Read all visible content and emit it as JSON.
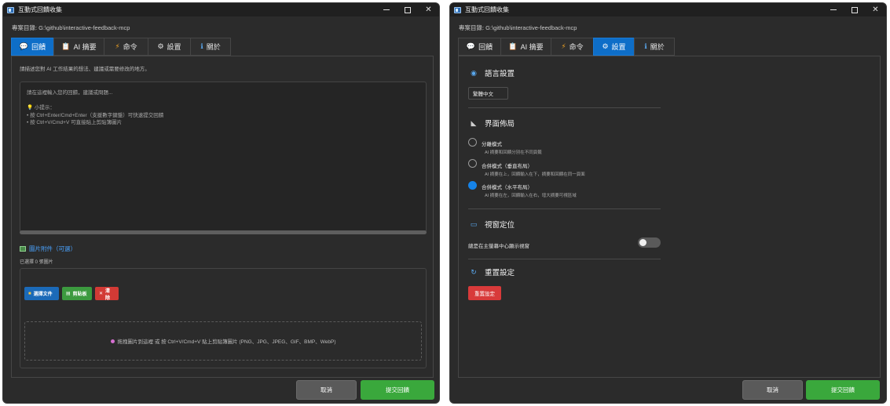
{
  "left": {
    "title": "互動式回饋收集",
    "project_path": "專案目錄: G:\\github\\interactive-feedback-mcp",
    "tabs": [
      {
        "icon": "💬",
        "label": "回饋"
      },
      {
        "icon": "📋",
        "label": "AI 摘要"
      },
      {
        "icon": "⚡",
        "label": "命令"
      },
      {
        "icon": "⚙",
        "label": "設置"
      },
      {
        "icon": "ℹ",
        "label": "關於"
      }
    ],
    "active_tab": "回饋",
    "feedback_hint": "請描述您對 AI 工作結果的想法、建議或需要修改的地方。",
    "feedback_placeholder": "請在這裡輸入您的回饋，建議或問題...",
    "tip_title": "💡 小提示：",
    "tip_line1": "• 按 Ctrl+Enter/Cmd+Enter（支援數字鍵盤）可快速提交回饋",
    "tip_line2": "• 按 Ctrl+V/Cmd+V 可直接貼上剪貼簿圖片",
    "image_section_title": "圖片附件（可選）",
    "image_count": "已選擇 0 張圖片",
    "btn_select_file": "選擇文件",
    "btn_clipboard": "剪貼板",
    "btn_clear": "清除",
    "drop_hint": "拖拽圖片到這裡 或 按 Ctrl+V/Cmd+V 貼上剪貼簿圖片 (PNG、JPG、JPEG、GIF、BMP、WebP)",
    "cancel": "取消",
    "submit": "提交回饋"
  },
  "right": {
    "title": "互動式回饋收集",
    "project_path": "專案目錄: G:\\github\\interactive-feedback-mcp",
    "tabs": [
      {
        "icon": "💬",
        "label": "回饋"
      },
      {
        "icon": "📋",
        "label": "AI 摘要"
      },
      {
        "icon": "⚡",
        "label": "命令"
      },
      {
        "icon": "⚙",
        "label": "設置"
      },
      {
        "icon": "ℹ",
        "label": "關於"
      }
    ],
    "active_tab": "設置",
    "language_section": "語言設置",
    "language_value": "繁體中文",
    "layout_section": "界面佈局",
    "layout_options": [
      {
        "title": "分離模式",
        "desc": "AI 摘要和回饋分別在不同頁籤",
        "selected": false
      },
      {
        "title": "合併模式（垂直布局）",
        "desc": "AI 摘要在上，回饋輸入在下，摘要和回饋在同一頁面",
        "selected": false
      },
      {
        "title": "合併模式（水平布局）",
        "desc": "AI 摘要在左，回饋輸入在右，增大摘要可視區域",
        "selected": true
      }
    ],
    "window_section": "視窗定位",
    "window_option": "總是在主螢幕中心顯示視窗",
    "window_option_enabled": false,
    "reset_section": "重置設定",
    "reset_button": "重置設定",
    "cancel": "取消",
    "submit": "提交回饋"
  },
  "colors": {
    "accent": "#0e6ec8",
    "submit": "#3aa83c",
    "danger": "#d23a35",
    "background": "#2b2b2b"
  }
}
